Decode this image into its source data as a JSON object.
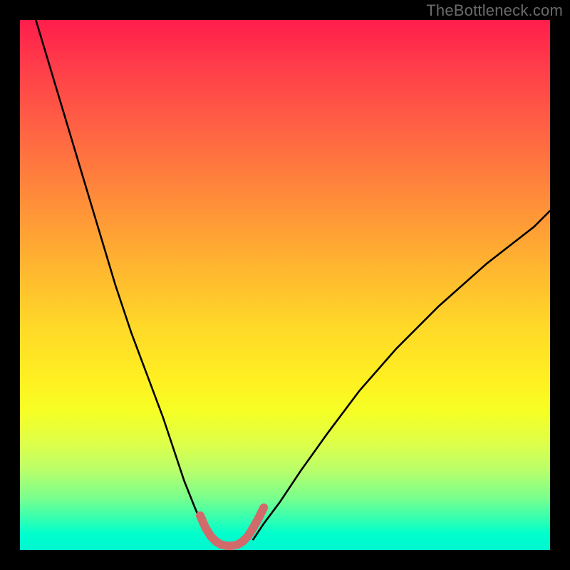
{
  "watermark": "TheBottleneck.com",
  "chart_data": {
    "type": "line",
    "title": "",
    "xlabel": "",
    "ylabel": "",
    "xlim": [
      0,
      100
    ],
    "ylim": [
      0,
      100
    ],
    "legend": false,
    "grid": false,
    "background_gradient": {
      "top": "#ff1d4b",
      "mid": "#ffd928",
      "bottom": "#00ffcd"
    },
    "series": [
      {
        "name": "left-branch",
        "color": "#000000",
        "x": [
          3,
          6,
          9,
          12,
          15,
          18,
          21,
          24,
          27,
          29,
          31,
          33,
          34.5,
          36
        ],
        "y": [
          100,
          90,
          80,
          70,
          60,
          50,
          41,
          33,
          25,
          19,
          13,
          8,
          4.5,
          2
        ]
      },
      {
        "name": "right-branch",
        "color": "#000000",
        "x": [
          44,
          46,
          49,
          53,
          58,
          64,
          71,
          79,
          88,
          97,
          100
        ],
        "y": [
          2,
          5,
          9,
          15,
          22,
          30,
          38,
          46,
          54,
          61,
          64
        ]
      },
      {
        "name": "optimal-zone",
        "color": "#d16a6a",
        "x": [
          34,
          35,
          36,
          37,
          38,
          39,
          40,
          41,
          42,
          43,
          44,
          45,
          46
        ],
        "y": [
          6.5,
          4.2,
          2.6,
          1.6,
          1.0,
          0.8,
          0.8,
          1.0,
          1.6,
          2.6,
          4.2,
          6.0,
          8.0
        ]
      }
    ]
  }
}
